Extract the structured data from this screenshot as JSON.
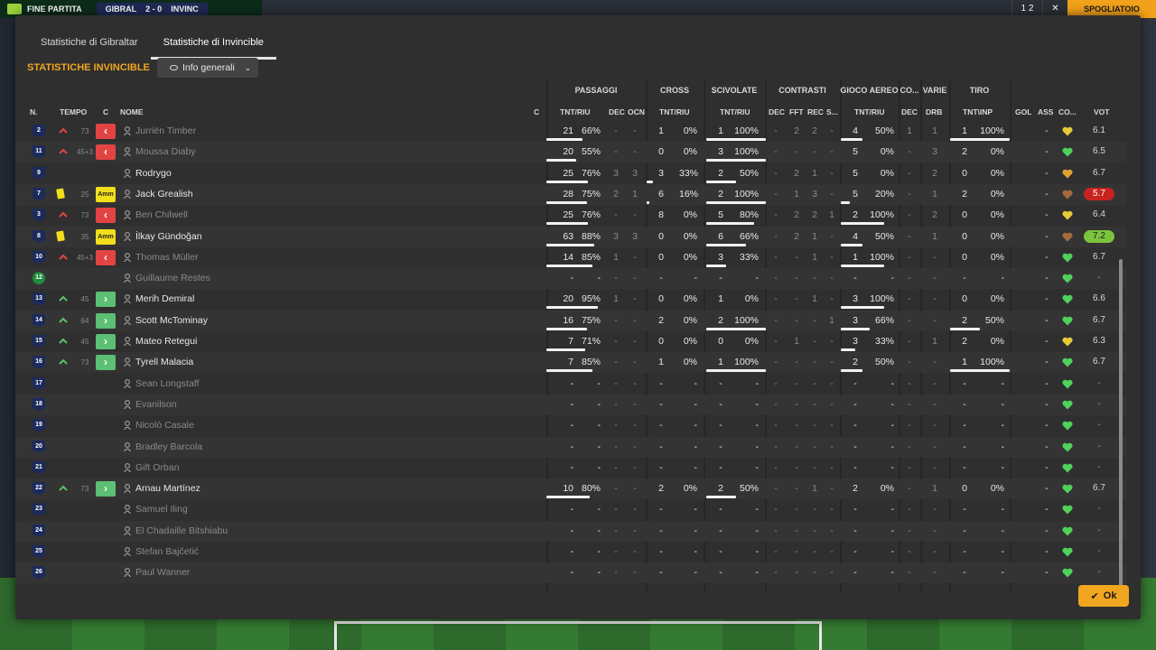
{
  "background": {
    "match_label": "FINE PARTITA",
    "home_abbr": "GIBRAL",
    "score": "2 - 0",
    "away_abbr": "INVINC",
    "top_right_count": "1 2",
    "top_right_action": "SPOGLIATOIO"
  },
  "tabs": [
    {
      "label": "Statistiche di Gibraltar",
      "active": false
    },
    {
      "label": "Statistiche di Invincible",
      "active": true
    }
  ],
  "section_title": "STATISTICHE INVINCIBLE",
  "view_select": {
    "label": "Info generali"
  },
  "groups": {
    "passaggi": "PASSAGGI",
    "cross": "CROSS",
    "scivolate": "SCIVOLATE",
    "contrasti": "CONTRASTI",
    "gioco_aereo": "GIOCO AEREO",
    "co": "CO...",
    "varie": "VARIE",
    "tiro": "TIRO"
  },
  "columns": {
    "n": "N.",
    "tempo": "TEMPO",
    "c": "C",
    "nome": "NOME",
    "c2": "C",
    "pass_tnt": "TNT/RIU",
    "pass_dec": "DEC",
    "pass_ocn": "OCN",
    "cross_tnt": "TNT/RIU",
    "sciv_tnt": "TNT/RIU",
    "con_dec": "DEC",
    "con_fft": "FFT",
    "con_rec": "REC",
    "con_s": "S...",
    "aereo_tnt": "TNT/RIU",
    "co_dec": "DEC",
    "var_drb": "DRB",
    "tiro_tnt": "TNT\\INP",
    "gol": "GOL",
    "ass": "ASS",
    "co2": "CO...",
    "vot": "VOT"
  },
  "players": [
    {
      "n": "2",
      "sub": "out",
      "min": "73",
      "pos": "out",
      "name": "Jurriën Timber",
      "dim": true,
      "pt": "21",
      "pp": "66%",
      "pd": "-",
      "po": "-",
      "ct": "1",
      "cp": "0%",
      "st": "1",
      "sp": "100%",
      "cd": "-",
      "cf": "2",
      "cr": "2",
      "cs": "-",
      "at": "4",
      "ap": "50%",
      "od": "1",
      "vd": "1",
      "tt": "1",
      "tp": "100%",
      "gol": "",
      "ass": "-",
      "heart": "yellow",
      "vot": "6.1",
      "vstyle": "",
      "pbar": 0.66,
      "sbar": 1.0,
      "abar": 0.5,
      "tbar": 1.0
    },
    {
      "n": "11",
      "sub": "out",
      "min": "45+3",
      "pos": "out",
      "name": "Moussa Diaby",
      "dim": true,
      "pt": "20",
      "pp": "55%",
      "pd": "-",
      "po": "-",
      "ct": "0",
      "cp": "0%",
      "st": "3",
      "sp": "100%",
      "cd": "-",
      "cf": "-",
      "cr": "-",
      "cs": "-",
      "at": "5",
      "ap": "0%",
      "od": "-",
      "vd": "3",
      "tt": "2",
      "tp": "0%",
      "gol": "",
      "ass": "-",
      "heart": "green",
      "vot": "6.5",
      "vstyle": "",
      "pbar": 0.55,
      "sbar": 1.0,
      "abar": 0,
      "tbar": 0
    },
    {
      "n": "9",
      "sub": "",
      "min": "",
      "pos": "",
      "name": "Rodrygo",
      "dim": false,
      "pt": "25",
      "pp": "76%",
      "pd": "3",
      "po": "3",
      "ct": "3",
      "cp": "33%",
      "st": "2",
      "sp": "50%",
      "cd": "-",
      "cf": "2",
      "cr": "1",
      "cs": "-",
      "at": "5",
      "ap": "0%",
      "od": "-",
      "vd": "2",
      "tt": "0",
      "tp": "0%",
      "gol": "",
      "ass": "-",
      "heart": "orange",
      "vot": "6.7",
      "vstyle": "",
      "pbar": 0.76,
      "cbar": 0.33,
      "sbar": 0.5,
      "abar": 0,
      "tbar": 0
    },
    {
      "n": "7",
      "sub": "card",
      "min": "25",
      "pos": "amm",
      "name": "Jack Grealish",
      "dim": false,
      "pt": "28",
      "pp": "75%",
      "pd": "2",
      "po": "1",
      "ct": "6",
      "cp": "16%",
      "st": "2",
      "sp": "100%",
      "cd": "-",
      "cf": "1",
      "cr": "3",
      "cs": "-",
      "at": "5",
      "ap": "20%",
      "od": "-",
      "vd": "1",
      "tt": "2",
      "tp": "0%",
      "gol": "",
      "ass": "-",
      "heart": "brown",
      "vot": "5.7",
      "vstyle": "bad",
      "pbar": 0.75,
      "cbar": 0.16,
      "sbar": 1.0,
      "abar": 0.2,
      "tbar": 0
    },
    {
      "n": "3",
      "sub": "out",
      "min": "73",
      "pos": "out",
      "name": "Ben Chilwell",
      "dim": true,
      "pt": "25",
      "pp": "76%",
      "pd": "-",
      "po": "-",
      "ct": "8",
      "cp": "0%",
      "st": "5",
      "sp": "80%",
      "cd": "-",
      "cf": "2",
      "cr": "2",
      "cs": "1",
      "at": "2",
      "ap": "100%",
      "od": "-",
      "vd": "2",
      "tt": "0",
      "tp": "0%",
      "gol": "",
      "ass": "-",
      "heart": "yellow",
      "vot": "6.4",
      "vstyle": "",
      "pbar": 0.76,
      "sbar": 0.8,
      "abar": 1.0,
      "tbar": 0
    },
    {
      "n": "8",
      "sub": "card",
      "min": "35",
      "pos": "amm",
      "name": "İlkay Gündoğan",
      "dim": false,
      "pt": "63",
      "pp": "88%",
      "pd": "3",
      "po": "3",
      "ct": "0",
      "cp": "0%",
      "st": "6",
      "sp": "66%",
      "cd": "-",
      "cf": "2",
      "cr": "1",
      "cs": "-",
      "at": "4",
      "ap": "50%",
      "od": "-",
      "vd": "1",
      "tt": "0",
      "tp": "0%",
      "gol": "",
      "ass": "-",
      "heart": "brown",
      "vot": "7.2",
      "vstyle": "good",
      "pbar": 0.88,
      "sbar": 0.66,
      "abar": 0.5,
      "tbar": 0
    },
    {
      "n": "10",
      "sub": "out",
      "min": "45+3",
      "pos": "out",
      "name": "Thomas Müller",
      "dim": true,
      "pt": "14",
      "pp": "85%",
      "pd": "1",
      "po": "-",
      "ct": "0",
      "cp": "0%",
      "st": "3",
      "sp": "33%",
      "cd": "-",
      "cf": "-",
      "cr": "1",
      "cs": "-",
      "at": "1",
      "ap": "100%",
      "od": "-",
      "vd": "-",
      "tt": "0",
      "tp": "0%",
      "gol": "",
      "ass": "-",
      "heart": "green",
      "vot": "6.7",
      "vstyle": "",
      "pbar": 0.85,
      "sbar": 0.33,
      "abar": 1.0,
      "tbar": 0
    },
    {
      "n": "12",
      "sub": "",
      "min": "",
      "pos": "",
      "name": "Guillaume Restes",
      "dim": true,
      "gk": true,
      "empty": true,
      "heart": "green",
      "vot": "-",
      "vstyle": ""
    },
    {
      "n": "13",
      "sub": "in",
      "min": "45",
      "pos": "in",
      "name": "Merih Demiral",
      "dim": false,
      "pt": "20",
      "pp": "95%",
      "pd": "1",
      "po": "-",
      "ct": "0",
      "cp": "0%",
      "st": "1",
      "sp": "0%",
      "cd": "-",
      "cf": "-",
      "cr": "1",
      "cs": "-",
      "at": "3",
      "ap": "100%",
      "od": "-",
      "vd": "-",
      "tt": "0",
      "tp": "0%",
      "gol": "",
      "ass": "-",
      "heart": "green",
      "vot": "6.6",
      "vstyle": "",
      "pbar": 0.95,
      "sbar": 0,
      "abar": 1.0,
      "tbar": 0
    },
    {
      "n": "14",
      "sub": "in",
      "min": "64",
      "pos": "in",
      "name": "Scott McTominay",
      "dim": false,
      "pt": "16",
      "pp": "75%",
      "pd": "-",
      "po": "-",
      "ct": "2",
      "cp": "0%",
      "st": "2",
      "sp": "100%",
      "cd": "-",
      "cf": "-",
      "cr": "-",
      "cs": "1",
      "at": "3",
      "ap": "66%",
      "od": "-",
      "vd": "-",
      "tt": "2",
      "tp": "50%",
      "gol": "",
      "ass": "-",
      "heart": "green",
      "vot": "6.7",
      "vstyle": "",
      "pbar": 0.75,
      "sbar": 1.0,
      "abar": 0.66,
      "tbar": 0.5
    },
    {
      "n": "15",
      "sub": "in",
      "min": "45",
      "pos": "in",
      "name": "Mateo Retegui",
      "dim": false,
      "pt": "7",
      "pp": "71%",
      "pd": "-",
      "po": "-",
      "ct": "0",
      "cp": "0%",
      "st": "0",
      "sp": "0%",
      "cd": "-",
      "cf": "1",
      "cr": "-",
      "cs": "-",
      "at": "3",
      "ap": "33%",
      "od": "-",
      "vd": "1",
      "tt": "2",
      "tp": "0%",
      "gol": "",
      "ass": "-",
      "heart": "yellow",
      "vot": "6.3",
      "vstyle": "",
      "pbar": 0.71,
      "sbar": 0,
      "abar": 0.33,
      "tbar": 0
    },
    {
      "n": "16",
      "sub": "in",
      "min": "73",
      "pos": "in",
      "name": "Tyrell Malacia",
      "dim": false,
      "pt": "7",
      "pp": "85%",
      "pd": "-",
      "po": "-",
      "ct": "1",
      "cp": "0%",
      "st": "1",
      "sp": "100%",
      "cd": "-",
      "cf": "-",
      "cr": "-",
      "cs": "-",
      "at": "2",
      "ap": "50%",
      "od": "-",
      "vd": "-",
      "tt": "1",
      "tp": "100%",
      "gol": "",
      "ass": "-",
      "heart": "green",
      "vot": "6.7",
      "vstyle": "",
      "pbar": 0.85,
      "sbar": 1.0,
      "abar": 0.5,
      "tbar": 1.0
    },
    {
      "n": "17",
      "sub": "",
      "min": "",
      "pos": "",
      "name": "Sean Longstaff",
      "dim": true,
      "empty": true,
      "heart": "green",
      "vot": "-",
      "vstyle": ""
    },
    {
      "n": "18",
      "sub": "",
      "min": "",
      "pos": "",
      "name": "Evanilson",
      "dim": true,
      "empty": true,
      "heart": "green",
      "vot": "-",
      "vstyle": ""
    },
    {
      "n": "19",
      "sub": "",
      "min": "",
      "pos": "",
      "name": "Nicolò Casale",
      "dim": true,
      "empty": true,
      "heart": "green",
      "vot": "-",
      "vstyle": ""
    },
    {
      "n": "20",
      "sub": "",
      "min": "",
      "pos": "",
      "name": "Bradley Barcola",
      "dim": true,
      "empty": true,
      "heart": "green",
      "vot": "-",
      "vstyle": ""
    },
    {
      "n": "21",
      "sub": "",
      "min": "",
      "pos": "",
      "name": "Gift Orban",
      "dim": true,
      "empty": true,
      "heart": "green",
      "vot": "-",
      "vstyle": ""
    },
    {
      "n": "22",
      "sub": "in",
      "min": "73",
      "pos": "in",
      "name": "Arnau Martínez",
      "dim": false,
      "pt": "10",
      "pp": "80%",
      "pd": "-",
      "po": "-",
      "ct": "2",
      "cp": "0%",
      "st": "2",
      "sp": "50%",
      "cd": "-",
      "cf": "-",
      "cr": "1",
      "cs": "-",
      "at": "2",
      "ap": "0%",
      "od": "-",
      "vd": "1",
      "tt": "0",
      "tp": "0%",
      "gol": "",
      "ass": "-",
      "heart": "green",
      "vot": "6.7",
      "vstyle": "",
      "pbar": 0.8,
      "sbar": 0.5,
      "abar": 0,
      "tbar": 0
    },
    {
      "n": "23",
      "sub": "",
      "min": "",
      "pos": "",
      "name": "Samuel Iling",
      "dim": true,
      "empty": true,
      "heart": "green",
      "vot": "-",
      "vstyle": ""
    },
    {
      "n": "24",
      "sub": "",
      "min": "",
      "pos": "",
      "name": "El Chadaille Bitshiabu",
      "dim": true,
      "empty": true,
      "heart": "green",
      "vot": "-",
      "vstyle": ""
    },
    {
      "n": "25",
      "sub": "",
      "min": "",
      "pos": "",
      "name": "Stefan Bajčetić",
      "dim": true,
      "empty": true,
      "heart": "green",
      "vot": "-",
      "vstyle": ""
    },
    {
      "n": "26",
      "sub": "",
      "min": "",
      "pos": "",
      "name": "Paul Wanner",
      "dim": true,
      "empty": true,
      "heart": "green",
      "vot": "-",
      "vstyle": ""
    }
  ],
  "colors": {
    "accent": "#f0a61f",
    "heart_green": "#4fd15a",
    "heart_yellow": "#e7c93a",
    "heart_orange": "#e0a133",
    "heart_brown": "#a86a3c"
  },
  "ok_button": {
    "label": "Ok"
  }
}
